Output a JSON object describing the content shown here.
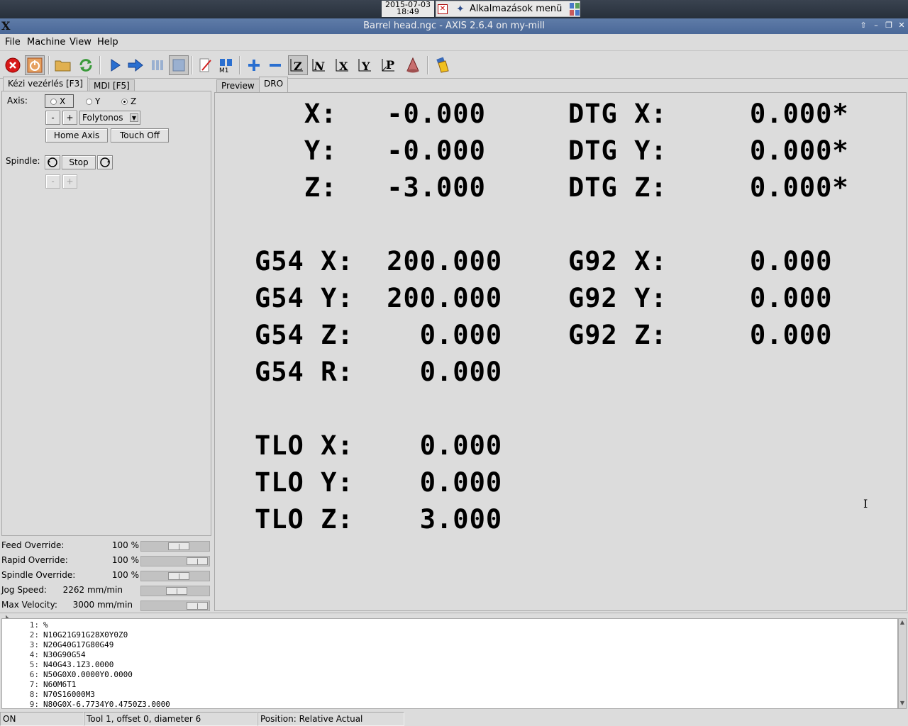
{
  "desktop": {
    "clock_date": "2015-07-03",
    "clock_time": "18:49",
    "taskbar_label": "Alkalmazások menü"
  },
  "window": {
    "title": "Barrel head.ngc - AXIS 2.6.4 on my-mill",
    "logo": "X"
  },
  "menu": {
    "file": "File",
    "machine": "Machine",
    "view": "View",
    "help": "Help"
  },
  "left_tabs": {
    "manual": "Kézi vezérlés [F3]",
    "mdi": "MDI [F5]"
  },
  "manual": {
    "axis_label": "Axis:",
    "axis_options": [
      "X",
      "Y",
      "Z"
    ],
    "selected_axis": "Z",
    "jog_minus": "-",
    "jog_plus": "+",
    "jog_mode": "Folytonos",
    "home_axis": "Home Axis",
    "touch_off": "Touch Off",
    "spindle_label": "Spindle:",
    "spindle_stop": "Stop",
    "spindle_minus": "-",
    "spindle_plus": "+"
  },
  "overrides": [
    {
      "label": "Feed Override:",
      "value": "100 %",
      "level": 0.6
    },
    {
      "label": "Rapid Override:",
      "value": "100 %",
      "level": 1.0
    },
    {
      "label": "Spindle Override:",
      "value": "100 %",
      "level": 0.6
    },
    {
      "label": "Jog Speed:",
      "value": "2262 mm/min",
      "level": 0.55
    },
    {
      "label": "Max Velocity:",
      "value": "3000 mm/min",
      "level": 1.0
    }
  ],
  "right_tabs": {
    "preview": "Preview",
    "dro": "DRO"
  },
  "dro": {
    "pos_x": "   X:   -0.000",
    "pos_y": "   Y:   -0.000",
    "pos_z": "   Z:   -3.000",
    "dtg_x": "DTG X:     0.000*",
    "dtg_y": "DTG Y:     0.000*",
    "dtg_z": "DTG Z:     0.000*",
    "g54_x": "G54 X:  200.000",
    "g54_y": "G54 Y:  200.000",
    "g54_z": "G54 Z:    0.000",
    "g54_r": "G54 R:    0.000",
    "g92_x": "G92 X:     0.000",
    "g92_y": "G92 Y:     0.000",
    "g92_z": "G92 Z:     0.000",
    "tlo_x": "TLO X:    0.000",
    "tlo_y": "TLO Y:    0.000",
    "tlo_z": "TLO Z:    3.000"
  },
  "gcode": [
    {
      "n": "1:",
      "code": "%"
    },
    {
      "n": "2:",
      "code": "N10G21G91G28X0Y0Z0"
    },
    {
      "n": "3:",
      "code": "N20G40G17G80G49"
    },
    {
      "n": "4:",
      "code": "N30G90G54"
    },
    {
      "n": "5:",
      "code": "N40G43.1Z3.0000"
    },
    {
      "n": "6:",
      "code": "N50G0X0.0000Y0.0000"
    },
    {
      "n": "7:",
      "code": "N60M6T1"
    },
    {
      "n": "8:",
      "code": "N70S16000M3"
    },
    {
      "n": "9:",
      "code": "N80G0X-6.7734Y0.4750Z3.0000"
    }
  ],
  "status": {
    "machine": "ON",
    "tool": "Tool 1, offset 0, diameter 6",
    "position": "Position: Relative Actual"
  },
  "colors": {
    "titlebar": "#5a77a4",
    "panel_bg": "#dcdcdc",
    "estop_red": "#d81818",
    "run_blue": "#2a6fd0"
  }
}
